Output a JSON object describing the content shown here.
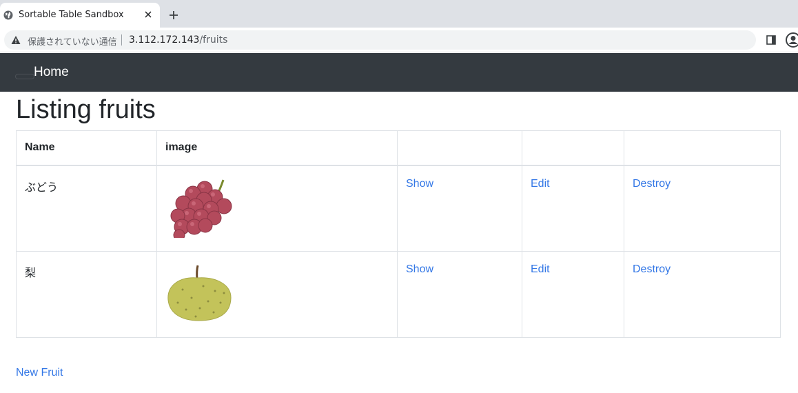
{
  "browser": {
    "tab_title": "Sortable Table Sandbox",
    "security_text": "保護されていない通信",
    "url_host": "3.112.172.143",
    "url_path": "/fruits"
  },
  "navbar": {
    "brand": "Home"
  },
  "page": {
    "title": "Listing fruits"
  },
  "table": {
    "headers": [
      "Name",
      "image",
      "",
      "",
      ""
    ],
    "rows": [
      {
        "name": "ぶどう",
        "image": "grapes-illustration",
        "show": "Show",
        "edit": "Edit",
        "destroy": "Destroy"
      },
      {
        "name": "梨",
        "image": "pear-illustration",
        "show": "Show",
        "edit": "Edit",
        "destroy": "Destroy"
      }
    ]
  },
  "links": {
    "new_fruit": "New Fruit"
  },
  "colors": {
    "navbar_bg": "#343a40",
    "link": "#3377e6",
    "grape": "#b34a5c",
    "pear": "#c3c35a"
  }
}
